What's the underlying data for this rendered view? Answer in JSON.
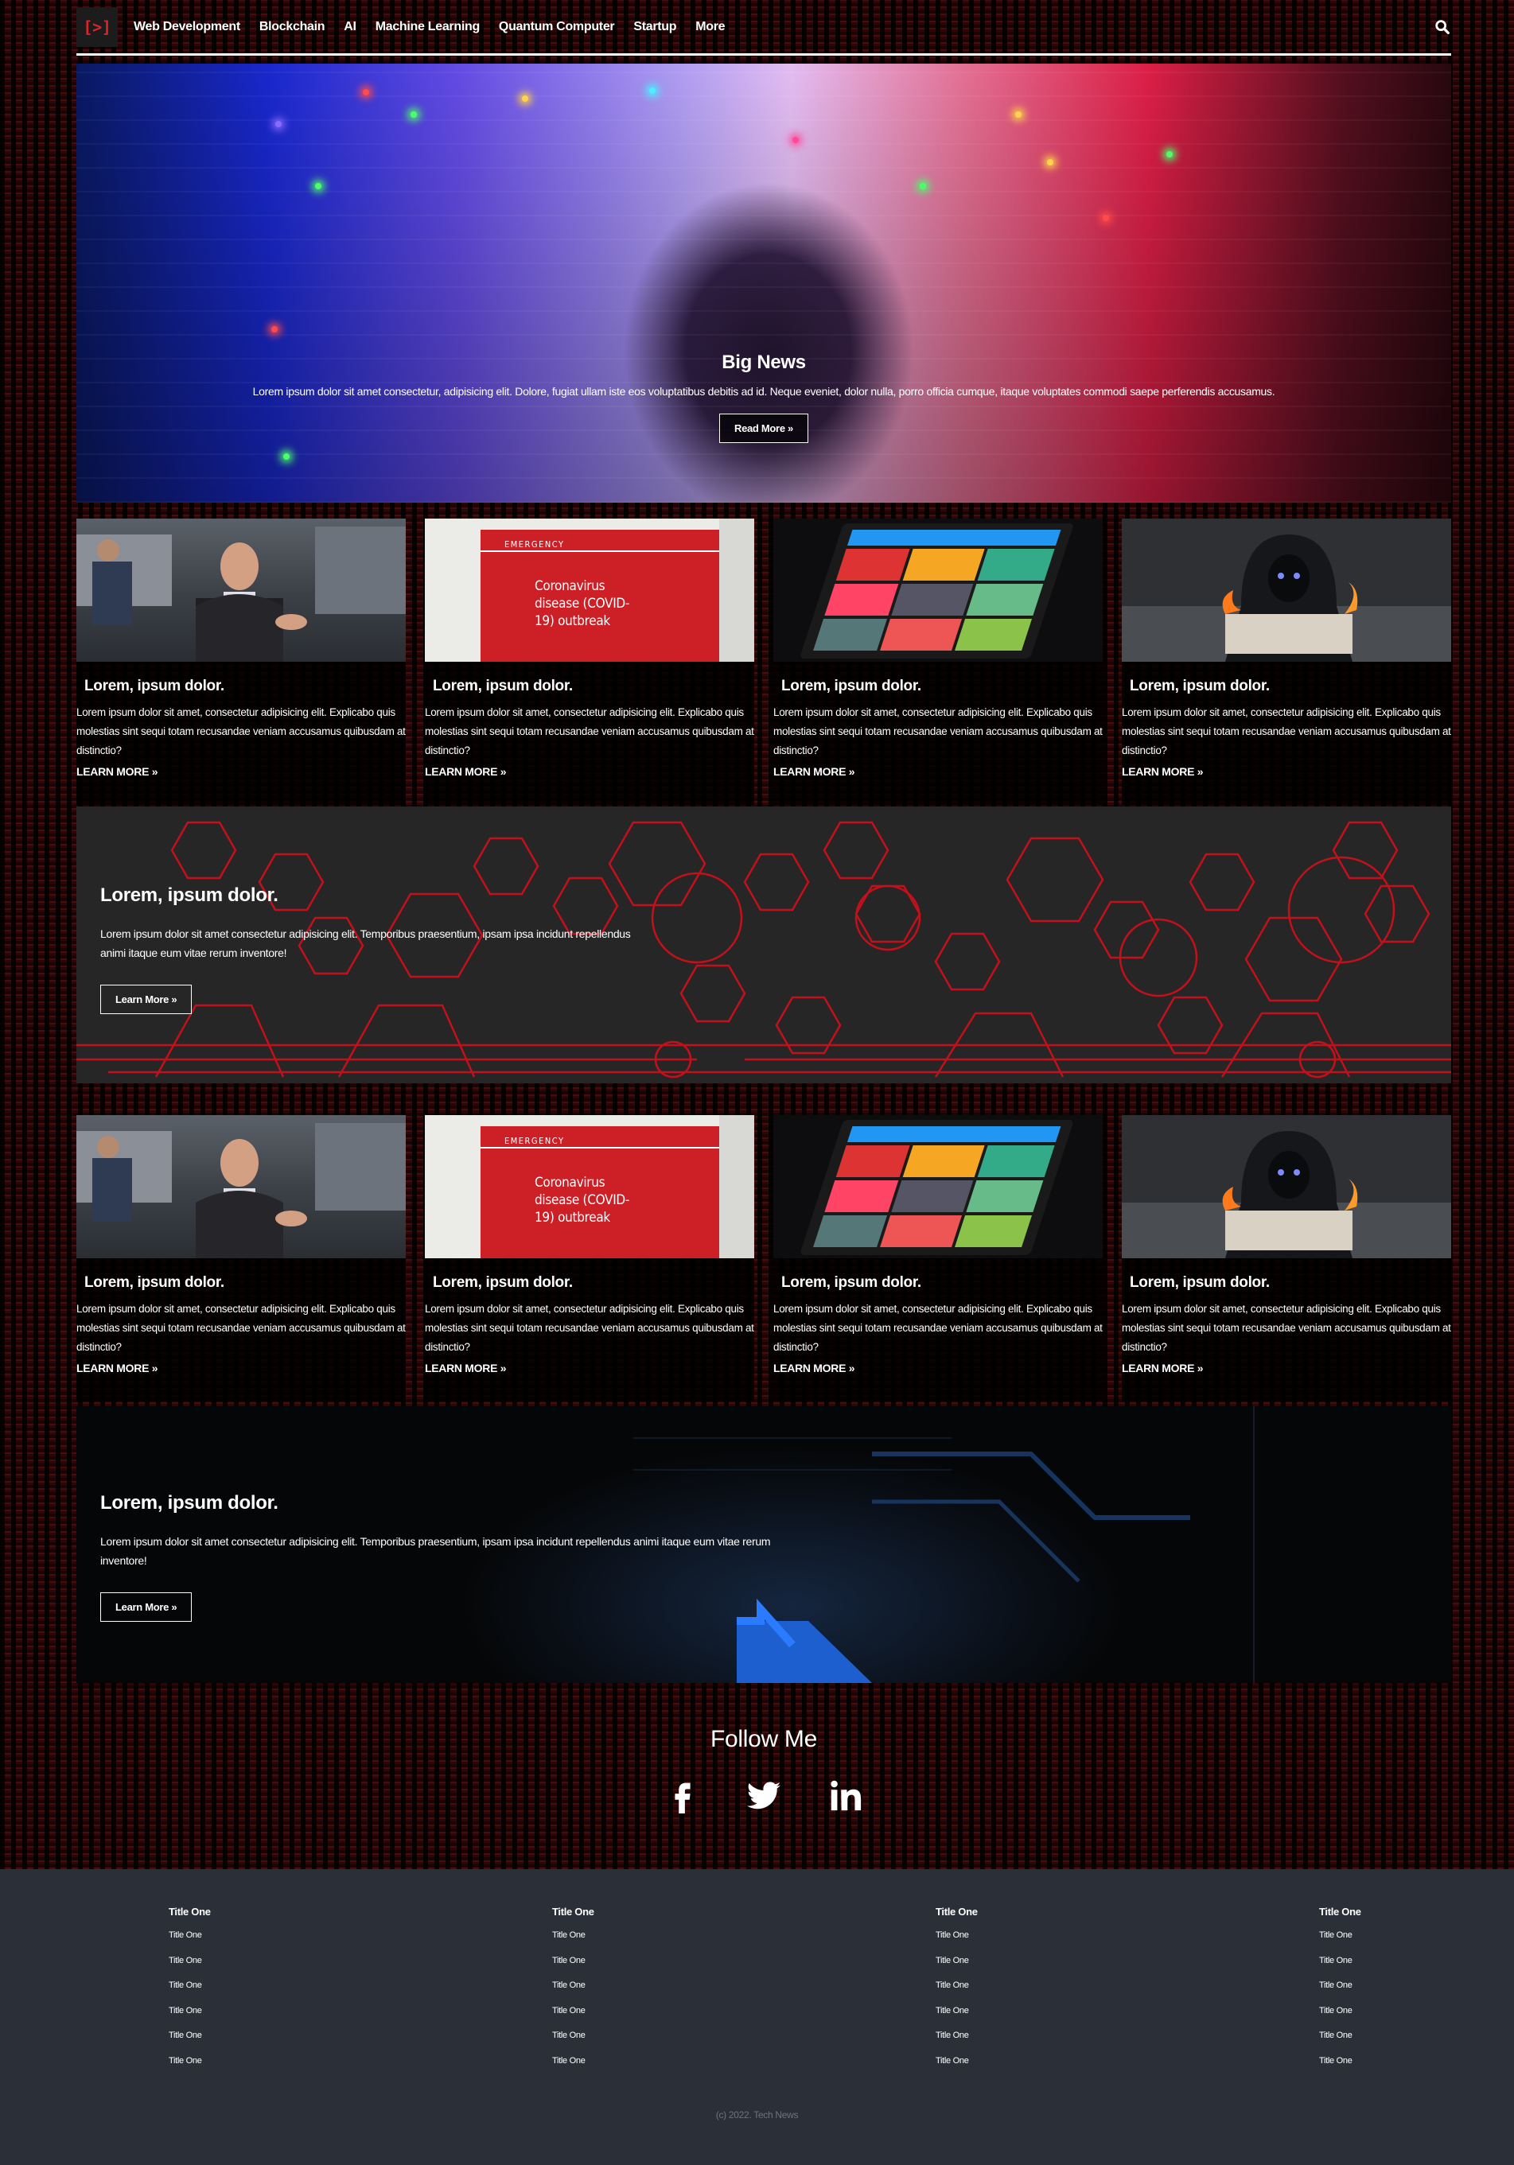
{
  "nav": {
    "logo": "[>]",
    "items": [
      "Web Development",
      "Blockchain",
      "AI",
      "Machine Learning",
      "Quantum Computer",
      "Startup",
      "More"
    ]
  },
  "hero": {
    "title": "Big News",
    "text": "Lorem ipsum dolor sit amet consectetur, adipisicing elit. Dolore, fugiat ullam iste eos voluptatibus debitis ad id. Neque eveniet, dolor nulla, porro officia cumque, itaque voluptates commodi saepe perferendis accusamus.",
    "button": "Read More »"
  },
  "cards_row1": [
    {
      "title": "Lorem, ipsum dolor.",
      "text": "Lorem ipsum dolor sit amet, consectetur adipisicing elit. Explicabo quis molestias sint sequi totam recusandae veniam accusamus quibusdam at distinctio?",
      "link": "LEARN MORE »"
    },
    {
      "title": "Lorem, ipsum dolor.",
      "text": "Lorem ipsum dolor sit amet, consectetur adipisicing elit. Explicabo quis molestias sint sequi totam recusandae veniam accusamus quibusdam at distinctio?",
      "link": "LEARN MORE »"
    },
    {
      "title": "Lorem, ipsum dolor.",
      "text": "Lorem ipsum dolor sit amet, consectetur adipisicing elit. Explicabo quis molestias sint sequi totam recusandae veniam accusamus quibusdam at distinctio?",
      "link": "LEARN MORE »"
    },
    {
      "title": "Lorem, ipsum dolor.",
      "text": "Lorem ipsum dolor sit amet, consectetur adipisicing elit. Explicabo quis molestias sint sequi totam recusandae veniam accusamus quibusdam at distinctio?",
      "link": "LEARN MORE »"
    }
  ],
  "cards_row2": [
    {
      "title": "Lorem, ipsum dolor.",
      "text": "Lorem ipsum dolor sit amet, consectetur adipisicing elit. Explicabo quis molestias sint sequi totam recusandae veniam accusamus quibusdam at distinctio?",
      "link": "LEARN MORE »"
    },
    {
      "title": "Lorem, ipsum dolor.",
      "text": "Lorem ipsum dolor sit amet, consectetur adipisicing elit. Explicabo quis molestias sint sequi totam recusandae veniam accusamus quibusdam at distinctio?",
      "link": "LEARN MORE »"
    },
    {
      "title": "Lorem, ipsum dolor.",
      "text": "Lorem ipsum dolor sit amet, consectetur adipisicing elit. Explicabo quis molestias sint sequi totam recusandae veniam accusamus quibusdam at distinctio?",
      "link": "LEARN MORE »"
    },
    {
      "title": "Lorem, ipsum dolor.",
      "text": "Lorem ipsum dolor sit amet, consectetur adipisicing elit. Explicabo quis molestias sint sequi totam recusandae veniam accusamus quibusdam at distinctio?",
      "link": "LEARN MORE »"
    }
  ],
  "card_image_text": {
    "emergency": "EMERGENCY",
    "covid": "Coronavirus disease (COVID-19) outbreak"
  },
  "banner1": {
    "title": "Lorem, ipsum dolor.",
    "text": "Lorem ipsum dolor sit amet consectetur adipisicing elit. Temporibus praesentium, ipsam ipsa incidunt repellendus animi itaque eum vitae rerum inventore!",
    "button": "Learn More »"
  },
  "banner2": {
    "title": "Lorem, ipsum dolor.",
    "text": "Lorem ipsum dolor sit amet consectetur adipisicing elit. Temporibus praesentium, ipsam ipsa incidunt repellendus animi itaque eum vitae rerum inventore!",
    "button": "Learn More »"
  },
  "follow": {
    "title": "Follow Me",
    "icons": [
      "facebook-icon",
      "twitter-icon",
      "linkedin-icon"
    ]
  },
  "footer": {
    "columns": [
      {
        "head": "Title One",
        "items": [
          "Title One",
          "Title One",
          "Title One",
          "Title One",
          "Title One",
          "Title One"
        ]
      },
      {
        "head": "Title One",
        "items": [
          "Title One",
          "Title One",
          "Title One",
          "Title One",
          "Title One",
          "Title One"
        ]
      },
      {
        "head": "Title One",
        "items": [
          "Title One",
          "Title One",
          "Title One",
          "Title One",
          "Title One",
          "Title One"
        ]
      },
      {
        "head": "Title One",
        "items": [
          "Title One",
          "Title One",
          "Title One",
          "Title One",
          "Title One",
          "Title One"
        ]
      }
    ],
    "copyright": "(c) 2022. Tech News"
  },
  "colors": {
    "accent": "#e0232b",
    "footer_bg": "#2b2f38",
    "card_bg": "#000000"
  }
}
